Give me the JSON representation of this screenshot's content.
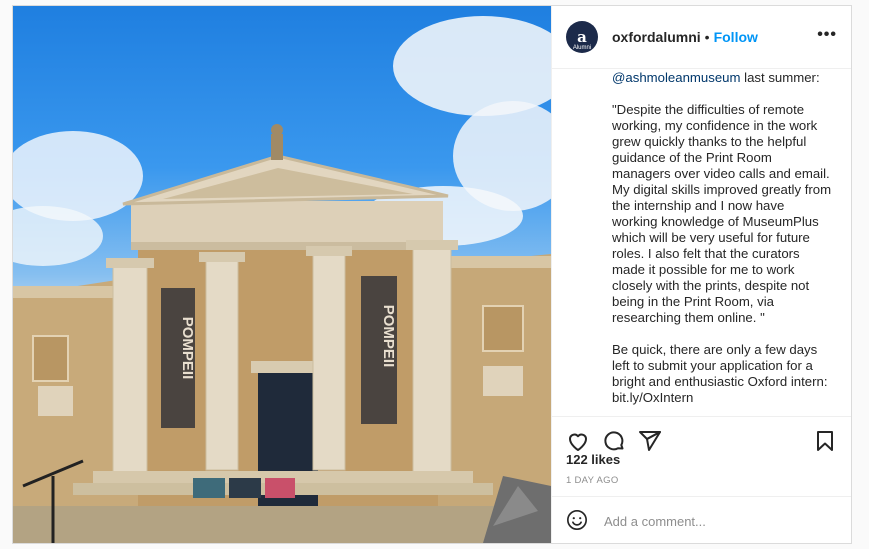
{
  "post": {
    "account": {
      "username": "oxfordalumni",
      "avatar_letter": "a",
      "avatar_sub": "Alumni",
      "follow_label": "Follow",
      "separator": "•",
      "more_label": "•••"
    },
    "image": {
      "banner_left": "POMPEII",
      "banner_right": "POMPEII"
    },
    "caption": {
      "mention": "@ashmoleanmuseum",
      "first_line_rest": " last summer:",
      "body": "\n\n\"Despite the difficulties of remote working, my confidence in the work grew quickly thanks to the helpful guidance of the Print Room managers over video calls and email. My digital skills improved greatly from the internship and I now have working knowledge of MuseumPlus which will be very useful for future roles. I also felt that the curators made it possible for me to work closely with the prints, despite not being in the Print Room, via researching them online. \"\n\nBe quick, there are only a few days left to submit your application for a bright and enthusiastic Oxford intern: bit.ly/OxIntern"
    },
    "actions": {
      "like_icon": "heart-icon",
      "comment_icon": "comment-icon",
      "share_icon": "paper-plane-icon",
      "save_icon": "bookmark-icon"
    },
    "likes": "122 likes",
    "time_ago": "1 DAY AGO",
    "comment": {
      "placeholder": "Add a comment...",
      "emoji_icon": "smiley-icon"
    }
  }
}
